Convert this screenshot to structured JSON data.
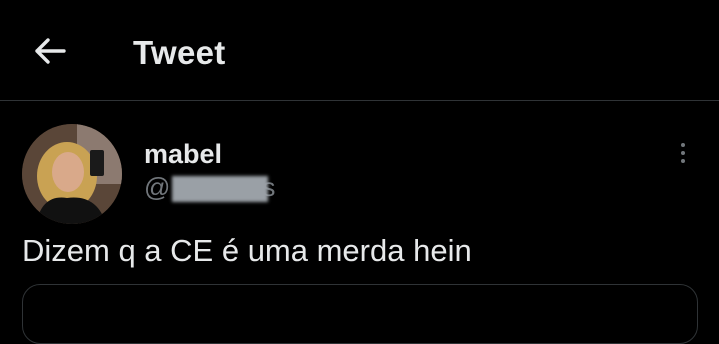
{
  "header": {
    "title": "Tweet",
    "back_icon": "arrow-left-icon"
  },
  "tweet": {
    "display_name": "mabel",
    "handle_prefix": "@",
    "handle_tail": "s",
    "text": "Dizem q a CE é uma merda hein",
    "more_icon": "more-vertical-icon"
  },
  "colors": {
    "background": "#000000",
    "primary_text": "#e7e9ea",
    "secondary_text": "#71767b",
    "divider": "#2f3336"
  }
}
